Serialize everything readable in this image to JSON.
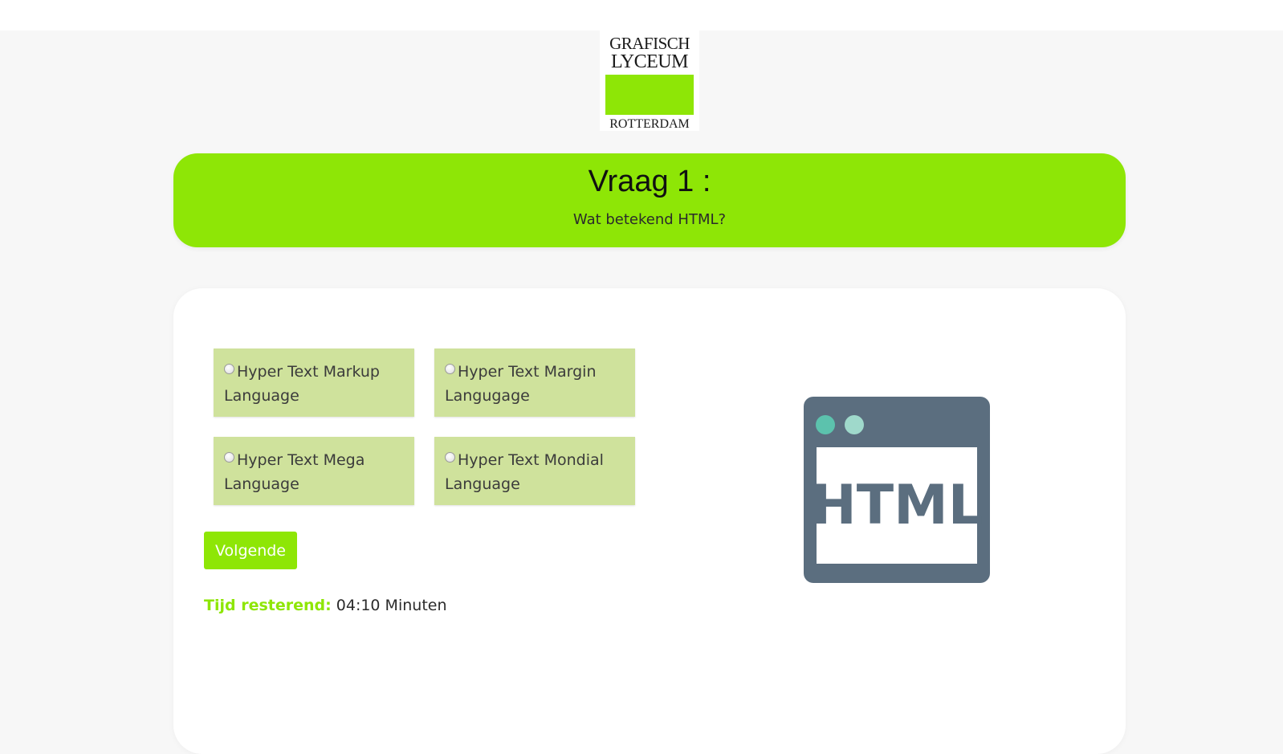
{
  "logo": {
    "line1": "GRAFISCH",
    "line2": "LYCEUM",
    "line3": "ROTTERDAM",
    "accent_color": "#8ee606"
  },
  "banner": {
    "title": "Vraag 1 :",
    "question": "Wat betekend HTML?",
    "color": "#8ee606"
  },
  "options": [
    {
      "label": "Hyper Text Markup Language",
      "selected": false
    },
    {
      "label": "Hyper Text Margin Langugage",
      "selected": false
    },
    {
      "label": "Hyper Text Mega Language",
      "selected": false
    },
    {
      "label": "Hyper Text Mondial Language",
      "selected": false
    }
  ],
  "actions": {
    "next_label": "Volgende"
  },
  "timer": {
    "label": "Tijd resterend:",
    "value": "04:10 Minuten"
  },
  "illustration": {
    "icon": "html-browser-window-icon",
    "text": "HTML",
    "frame_color": "#5b6e7f",
    "dot1_color": "#5cc2ad",
    "dot2_color": "#9fd9cb"
  }
}
